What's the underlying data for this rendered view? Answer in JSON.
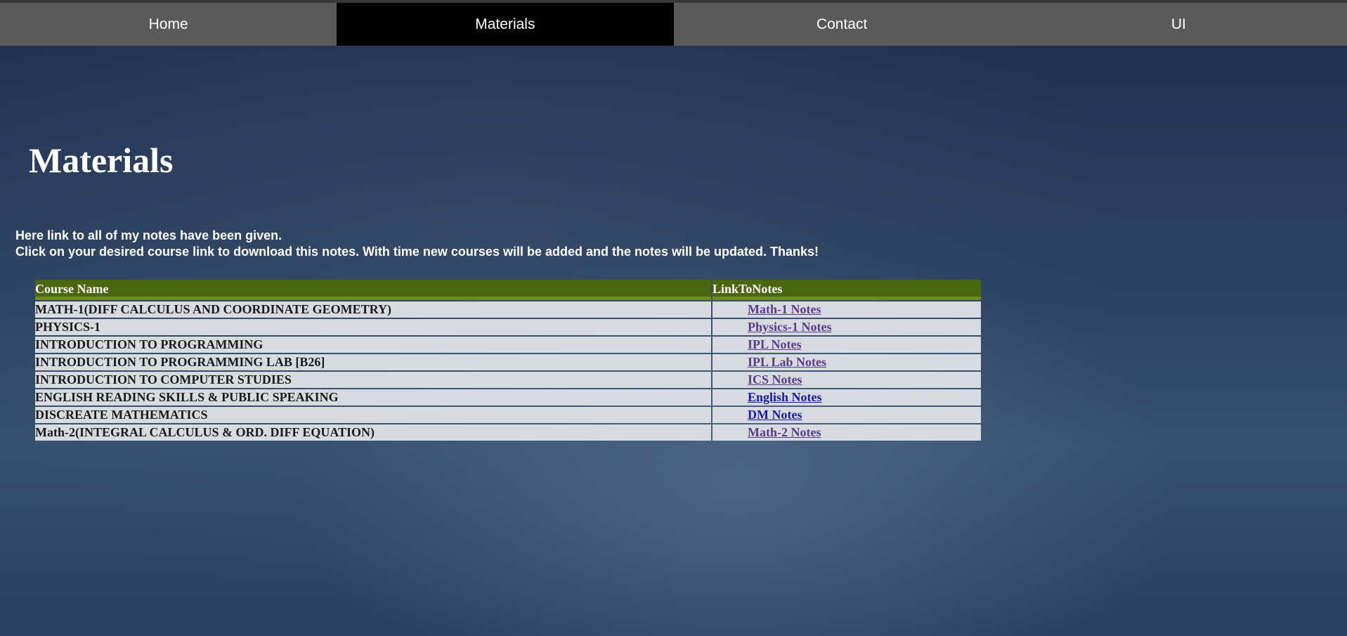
{
  "nav": {
    "items": [
      {
        "label": "Home"
      },
      {
        "label": "Materials"
      },
      {
        "label": "Contact"
      },
      {
        "label": "UI"
      }
    ],
    "active": "Materials"
  },
  "page": {
    "title": "Materials",
    "intro_line1": "Here link to all of my notes have been given.",
    "intro_line2": "Click on your desired course link to download this notes. With time new courses will be added and the notes will be updated. Thanks!"
  },
  "table": {
    "headers": [
      "Course Name",
      "LinkToNotes"
    ],
    "rows": [
      {
        "course": "MATH-1(DIFF CALCULUS AND COORDINATE GEOMETRY)",
        "link": "Math-1 Notes"
      },
      {
        "course": "PHYSICS-1",
        "link": "Physics-1 Notes"
      },
      {
        "course": "INTRODUCTION TO PROGRAMMING",
        "link": "IPL Notes"
      },
      {
        "course": "INTRODUCTION TO PROGRAMMING LAB [B26]",
        "link": "IPL Lab Notes"
      },
      {
        "course": "INTRODUCTION TO COMPUTER STUDIES",
        "link": "ICS Notes"
      },
      {
        "course": "ENGLISH READING SKILLS & PUBLIC SPEAKING",
        "link": "English Notes"
      },
      {
        "course": "DISCREATE MATHEMATICS",
        "link": "DM Notes"
      },
      {
        "course": "Math-2(INTEGRAL CALCULUS & ORD. DIFF EQUATION)",
        "link": "Math-2 Notes"
      }
    ]
  },
  "colors": {
    "nav_bg": "#5a5a5a",
    "nav_active_bg": "#000000",
    "table_header_bg": "#4a6610",
    "table_cell_bg": "#d7dbe0",
    "visited_link": "#5a3c8c",
    "unvisited_link": "#1a1aa8"
  }
}
